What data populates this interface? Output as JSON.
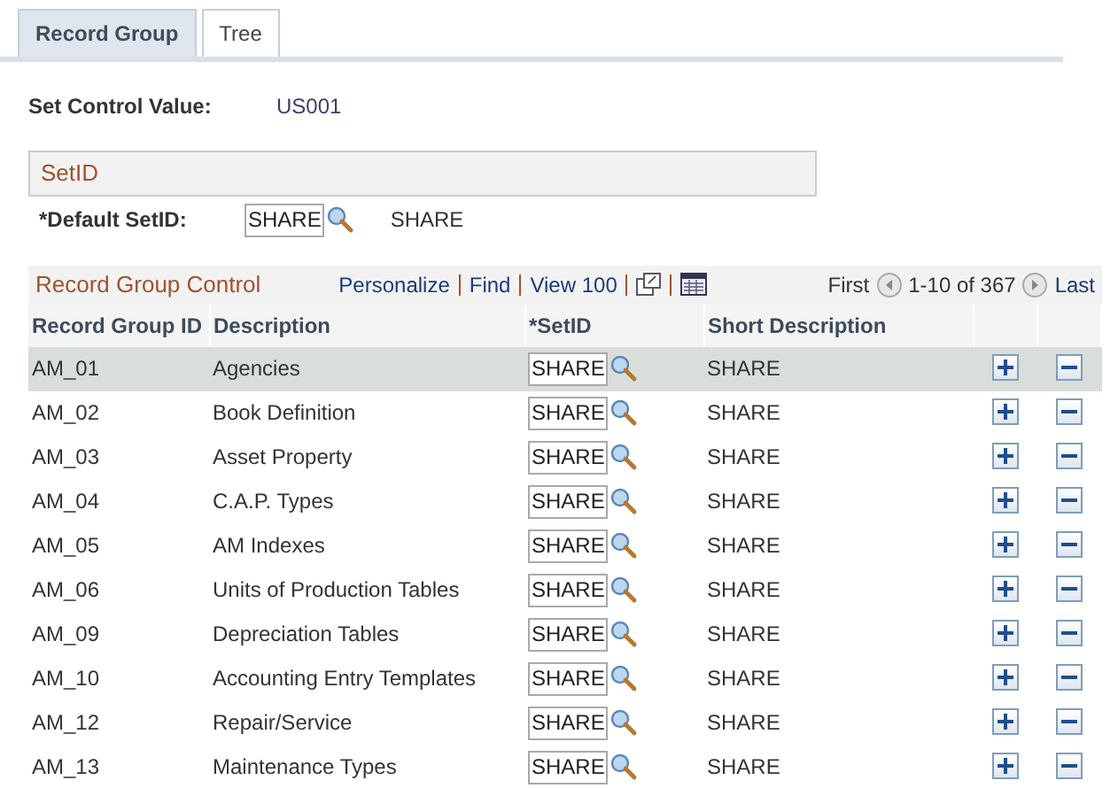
{
  "tabs": [
    {
      "label": "Record Group",
      "selected": true
    },
    {
      "label": "Tree",
      "selected": false
    }
  ],
  "set_control": {
    "label": "Set Control Value:",
    "value": "US001"
  },
  "setid_section": {
    "title": "SetID",
    "field_label": "*Default SetID:",
    "value": "SHARE",
    "description": "SHARE"
  },
  "grid": {
    "title": "Record Group Control",
    "links": [
      "Personalize",
      "Find",
      "View 100"
    ],
    "first": "First",
    "range": "1-10 of 367",
    "last": "Last",
    "columns": [
      "Record Group ID",
      "Description",
      "*SetID",
      "Short Description"
    ],
    "rows": [
      {
        "id": "AM_01",
        "description": "Agencies",
        "setid": "SHARE",
        "short": "SHARE",
        "selected": true
      },
      {
        "id": "AM_02",
        "description": "Book Definition",
        "setid": "SHARE",
        "short": "SHARE",
        "selected": false
      },
      {
        "id": "AM_03",
        "description": "Asset Property",
        "setid": "SHARE",
        "short": "SHARE",
        "selected": false
      },
      {
        "id": "AM_04",
        "description": "C.A.P. Types",
        "setid": "SHARE",
        "short": "SHARE",
        "selected": false
      },
      {
        "id": "AM_05",
        "description": "AM Indexes",
        "setid": "SHARE",
        "short": "SHARE",
        "selected": false
      },
      {
        "id": "AM_06",
        "description": "Units of Production Tables",
        "setid": "SHARE",
        "short": "SHARE",
        "selected": false
      },
      {
        "id": "AM_09",
        "description": "Depreciation Tables",
        "setid": "SHARE",
        "short": "SHARE",
        "selected": false
      },
      {
        "id": "AM_10",
        "description": "Accounting Entry Templates",
        "setid": "SHARE",
        "short": "SHARE",
        "selected": false
      },
      {
        "id": "AM_12",
        "description": "Repair/Service",
        "setid": "SHARE",
        "short": "SHARE",
        "selected": false
      },
      {
        "id": "AM_13",
        "description": "Maintenance Types",
        "setid": "SHARE",
        "short": "SHARE",
        "selected": false
      }
    ]
  }
}
